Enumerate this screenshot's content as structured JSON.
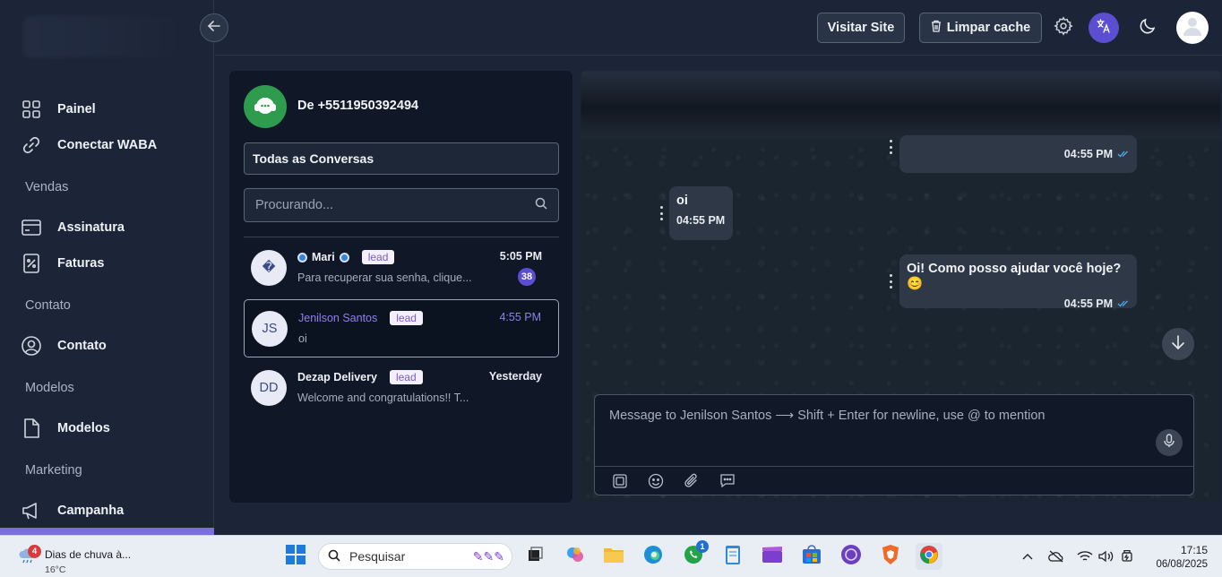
{
  "sidebar": {
    "items": [
      {
        "label": "Painel",
        "icon": "grid-icon"
      },
      {
        "label": "Conectar WABA",
        "icon": "link-icon"
      },
      {
        "label": "Assinatura",
        "icon": "credit-card-icon"
      },
      {
        "label": "Faturas",
        "icon": "invoice-icon"
      },
      {
        "label": "Contato",
        "icon": "user-circle-icon"
      },
      {
        "label": "Modelos",
        "icon": "document-icon"
      },
      {
        "label": "Campanha",
        "icon": "megaphone-icon"
      }
    ],
    "sections": [
      "Vendas",
      "Contato",
      "Modelos",
      "Marketing"
    ]
  },
  "topbar": {
    "visit_site": "Visitar Site",
    "clear_cache": "Limpar cache"
  },
  "conversations": {
    "from": "De +5511950392494",
    "filter_selected": "Todas as Conversas",
    "search_placeholder": "Procurando...",
    "list": [
      {
        "initials": "�",
        "name": "Mari",
        "badge": "lead",
        "preview": "Para recuperar sua senha, clique...",
        "time": "5:05 PM",
        "unread": "38"
      },
      {
        "initials": "JS",
        "name": "Jenilson Santos",
        "badge": "lead",
        "preview": "oi",
        "time": "4:55 PM"
      },
      {
        "initials": "DD",
        "name": "Dezap Delivery",
        "badge": "lead",
        "preview": "Welcome and congratulations!! T...",
        "time": "Yesterday"
      }
    ]
  },
  "chat": {
    "messages": [
      {
        "text": "",
        "time": "04:55 PM",
        "direction": "outgoing"
      },
      {
        "text": "oi",
        "time": "04:55 PM",
        "direction": "incoming"
      },
      {
        "text": "Oi! Como posso ajudar você hoje? 😊",
        "time": "04:55 PM",
        "direction": "outgoing"
      }
    ],
    "composer_placeholder": "Message to Jenilson Santos ⟶ Shift + Enter for newline, use @ to mention"
  },
  "taskbar": {
    "weather_title": "Dias de chuva à...",
    "weather_temp": "16°C",
    "weather_badge": "4",
    "search_label": "Pesquisar",
    "whatsapp_badge": "1",
    "clock_time": "17:15",
    "clock_date": "06/08/2025"
  },
  "colors": {
    "accent": "#5b4ed1",
    "whatsapp_green": "#2e9b4f",
    "background": "#1c2538",
    "panel": "#101828"
  }
}
